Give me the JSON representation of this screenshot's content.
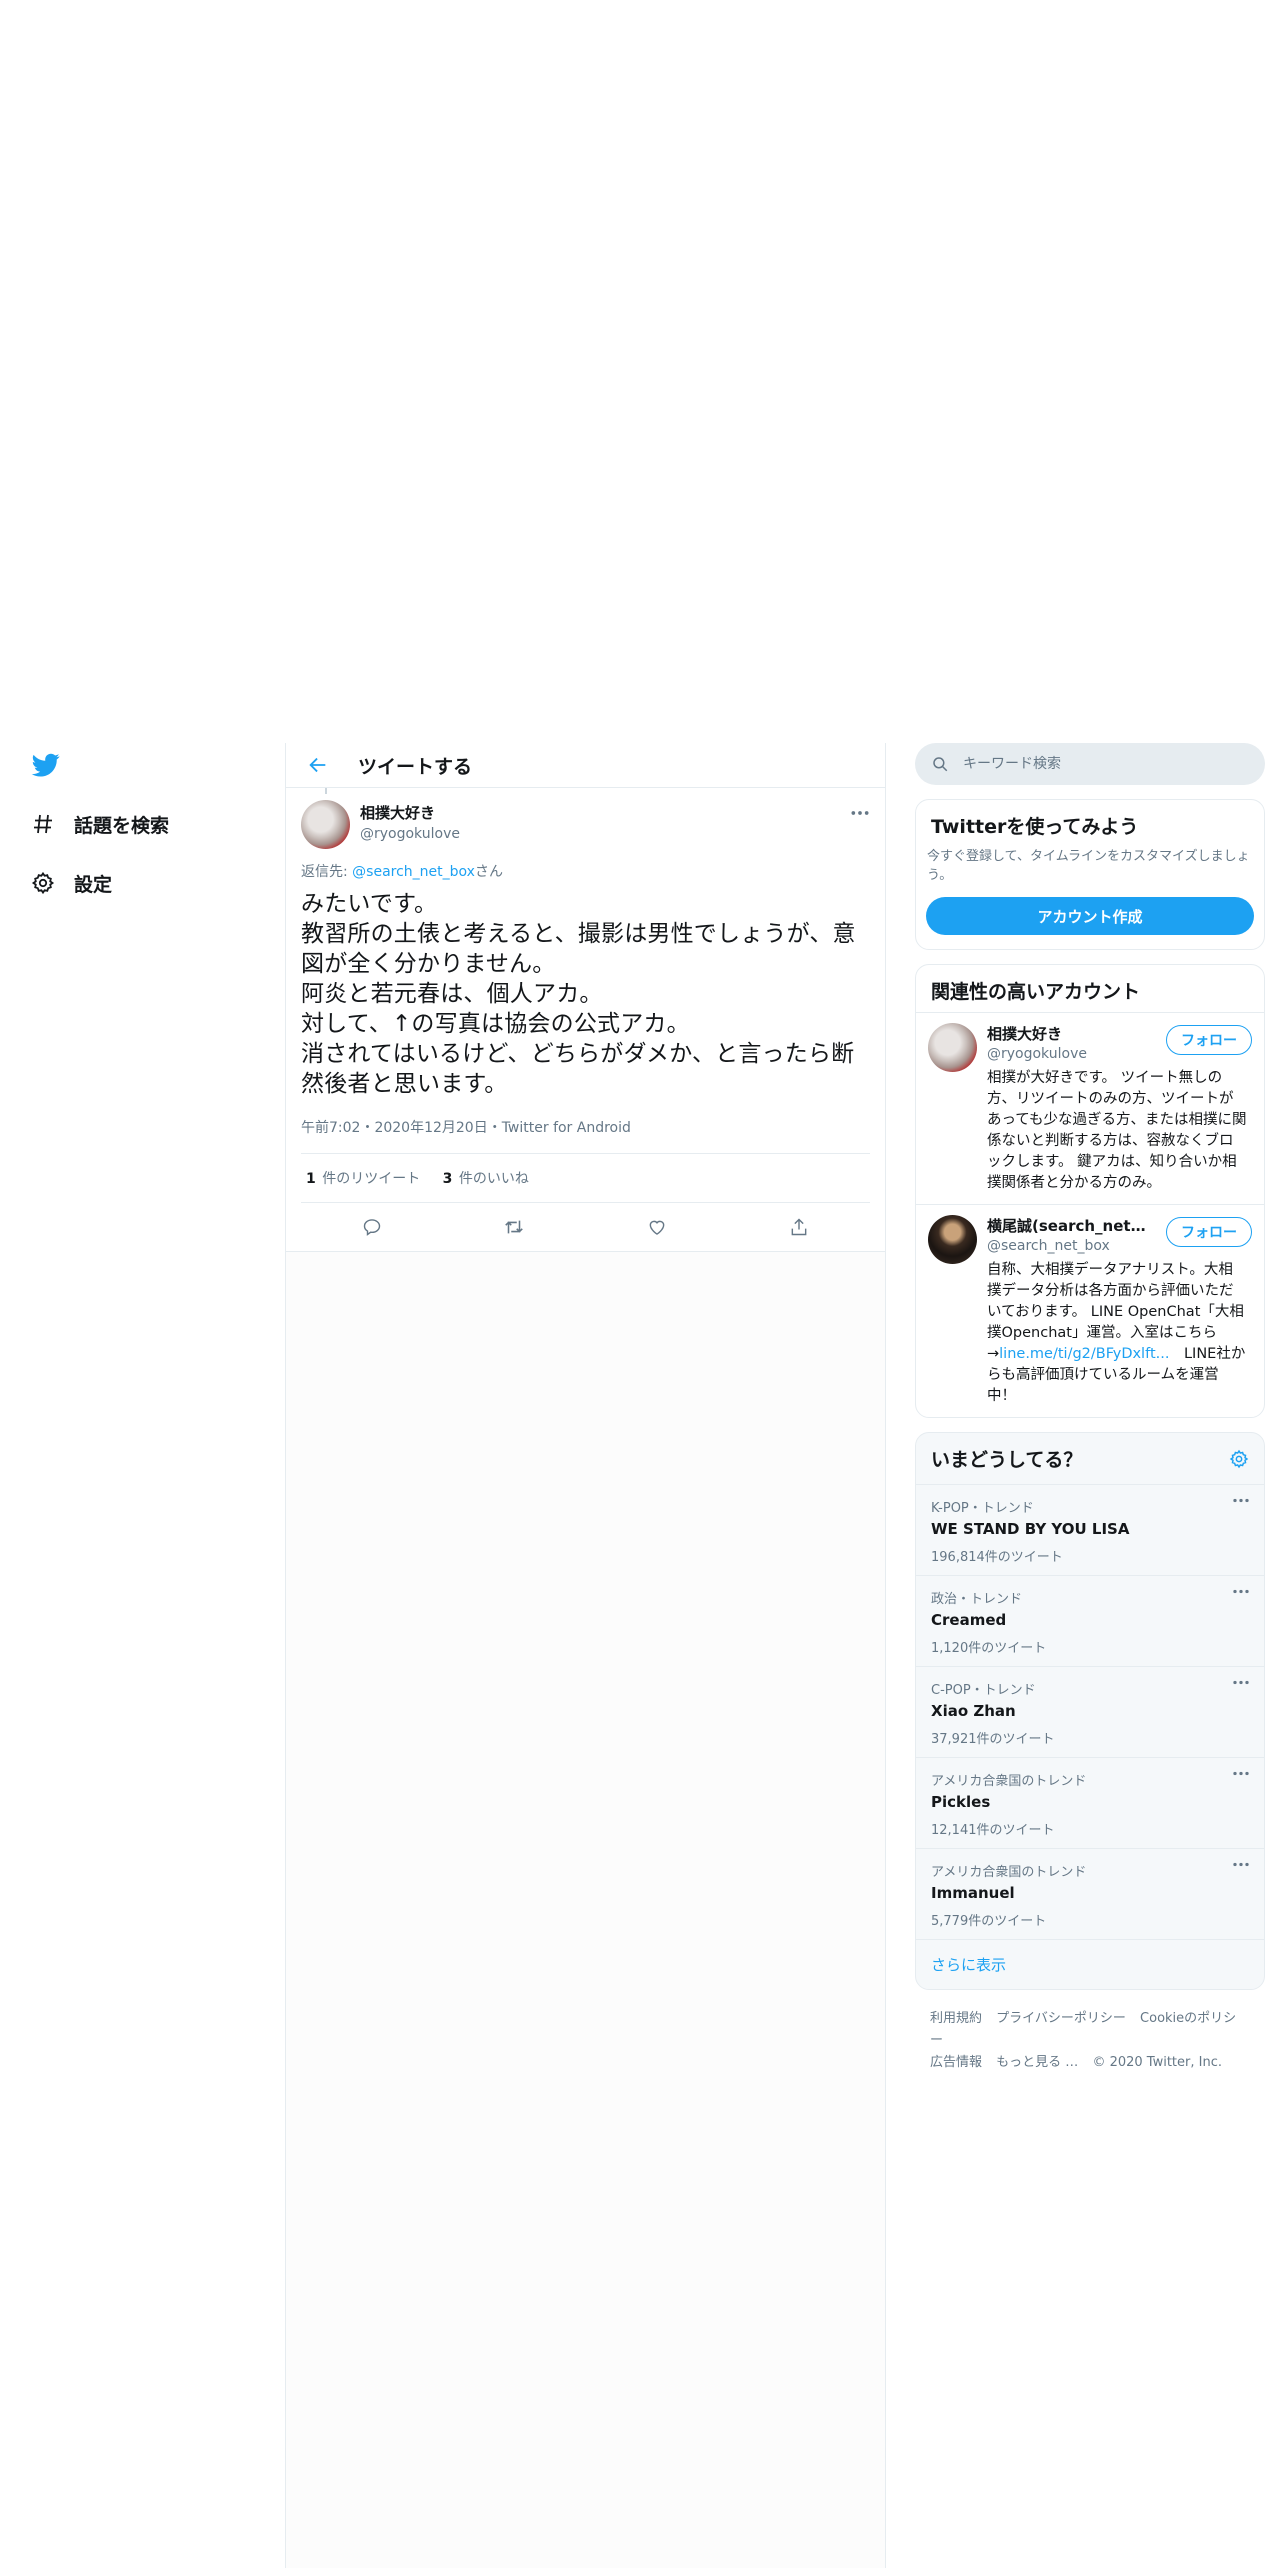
{
  "nav": {
    "items": [
      {
        "label": "話題を検索",
        "icon": "hashtag-icon"
      },
      {
        "label": "設定",
        "icon": "gear-icon"
      }
    ]
  },
  "main": {
    "header_title": "ツイートする"
  },
  "tweet": {
    "author_name": "相撲大好き",
    "author_handle": "@ryogokulove",
    "replying_prefix": "返信先: ",
    "replying_handle": "@search_net_box",
    "replying_suffix": "さん",
    "text": "みたいです。\n教習所の土俵と考えると、撮影は男性でしょうが、意図が全く分かりません。\n阿炎と若元春は、個人アカ。\n対して、↑の写真は協会の公式アカ。\n消されてはいるけど、どちらがダメか、と言ったら断然後者と思います。",
    "meta": "午前7:02・2020年12月20日・Twitter for Android",
    "retweets_count": "1",
    "retweets_label": "件のリツイート",
    "likes_count": "3",
    "likes_label": "件のいいね"
  },
  "search": {
    "placeholder": "キーワード検索"
  },
  "signup": {
    "title": "Twitterを使ってみよう",
    "desc": "今すぐ登録して、タイムラインをカスタマイズしましょう。",
    "button": "アカウント作成"
  },
  "related": {
    "title": "関連性の高いアカウント",
    "accounts": [
      {
        "name": "相撲大好き",
        "handle": "@ryogokulove",
        "follow": "フォロー",
        "bio": "相撲が大好きです。 ツイート無しの方、リツイートのみの方、ツイートがあっても少な過ぎる方、または相撲に関係ないと判断する方は、容赦なくブロックします。 鍵アカは、知り合いか相撲関係者と分かる方のみ。"
      },
      {
        "name": "横尾誠(search_net_b...",
        "handle": "@search_net_box",
        "follow": "フォロー",
        "bio_prefix": "自称、大相撲データアナリスト。大相撲データ分析は各方面から評価いただいております。 LINE OpenChat「大相撲Openchat」運営。入室はこちら→",
        "bio_link": "line.me/ti/g2/BFyDxlft...",
        "bio_suffix": "　LINE社からも高評価頂けているルームを運営中！"
      }
    ]
  },
  "trends": {
    "title": "いまどうしてる？",
    "items": [
      {
        "context": "K-POP・トレンド",
        "name": "WE STAND BY YOU LISA",
        "count": "196,814件のツイート"
      },
      {
        "context": "政治・トレンド",
        "name": "Creamed",
        "count": "1,120件のツイート"
      },
      {
        "context": "C-POP・トレンド",
        "name": "Xiao Zhan",
        "count": "37,921件のツイート"
      },
      {
        "context": "アメリカ合衆国のトレンド",
        "name": "Pickles",
        "count": "12,141件のツイート"
      },
      {
        "context": "アメリカ合衆国のトレンド",
        "name": "Immanuel",
        "count": "5,779件のツイート"
      }
    ],
    "show_more": "さらに表示"
  },
  "footer": {
    "links": [
      "利用規約",
      "プライバシーポリシー",
      "Cookieのポリシー",
      "広告情報",
      "もっと見る …"
    ],
    "copyright": "© 2020 Twitter, Inc."
  },
  "colors": {
    "accent": "#1da1f2",
    "muted": "#657786",
    "border": "#e6ecf0"
  }
}
